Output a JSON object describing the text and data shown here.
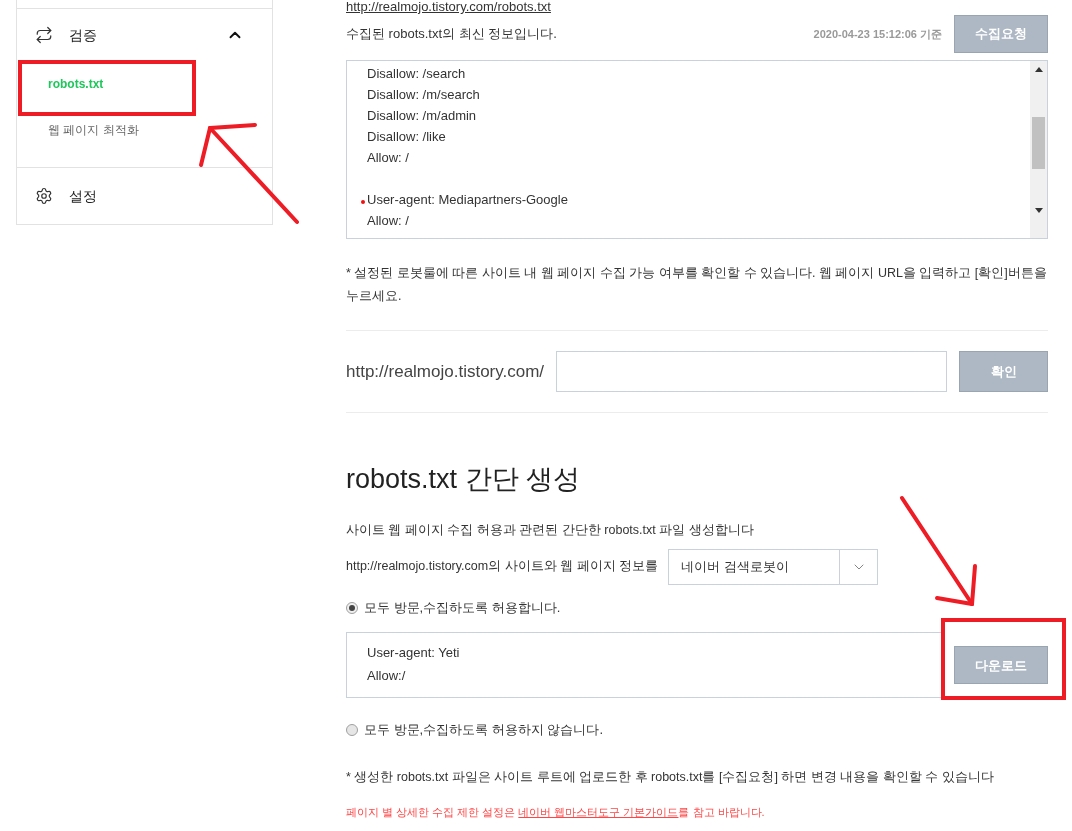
{
  "sidebar": {
    "groups": [
      {
        "label": "검증",
        "expanded": true,
        "items": [
          {
            "label": "robots.txt",
            "selected": true
          },
          {
            "label": "웹 페이지 최적화",
            "selected": false
          }
        ]
      },
      {
        "label": "설정"
      }
    ]
  },
  "robots_url": "http://realmojo.tistory.com/robots.txt",
  "collected": {
    "description": "수집된 robots.txt의 최신 정보입니다.",
    "timestamp": "2020-04-23 15:12:06 기준",
    "button": "수집요청",
    "blocks": [
      [
        "Disallow: /search",
        "Disallow: /m/search",
        "Disallow: /m/admin",
        "Disallow: /like",
        "Allow: /"
      ],
      [
        "User-agent: Mediapartners-Google",
        "Allow: /"
      ]
    ]
  },
  "check": {
    "note": "* 설정된 로봇룰에 따른 사이트 내 웹 페이지 수집 가능 여부를 확인할 수 있습니다. 웹 페이지 URL을 입력하고 [확인]버튼을 누르세요.",
    "prefix": "http://realmojo.tistory.com/",
    "button": "확인"
  },
  "generator": {
    "title": "robots.txt 간단 생성",
    "description": "사이트 웹 페이지 수집 허용과 관련된 간단한 robots.txt 파일 생성합니다",
    "site_label": "http://realmojo.tistory.com의 사이트와 웹 페이지 정보를",
    "robot_select": "네이버 검색로봇이",
    "options": [
      {
        "label": "모두 방문,수집하도록 허용합니다.",
        "selected": true
      },
      {
        "label": "모두 방문,수집하도록 허용하지 않습니다.",
        "selected": false
      }
    ],
    "output_lines": [
      "User-agent: Yeti",
      "Allow:/"
    ],
    "button": "다운로드",
    "note": "* 생성한 robots.txt 파일은 사이트 루트에 업로드한 후 robots.txt를 [수집요청] 하면 변경 내용을 확인할 수 있습니다",
    "warning_before": "페이지 별 상세한 수집 제한 설정은 ",
    "warning_link": "네이버 웹마스터도구 기본가이드",
    "warning_after": "를 참고 바랍니다."
  }
}
